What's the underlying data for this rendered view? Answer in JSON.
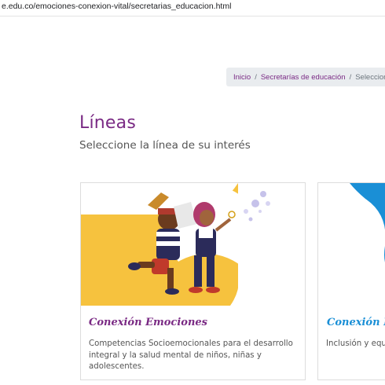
{
  "browser": {
    "url": "e.edu.co/emociones-conexion-vital/secretarias_educacion.html"
  },
  "breadcrumb": {
    "items": [
      "Inicio",
      "Secretarías de educación"
    ],
    "current": "Seleccionar líne"
  },
  "page": {
    "title": "Líneas",
    "subtitle": "Seleccione la línea de su interés"
  },
  "cards": [
    {
      "title": "Conexión Emociones",
      "description": "Competencias Socioemocionales para el desarrollo integral y la salud mental de niños, niñas y adolescentes.",
      "accent": "#7a2a84"
    },
    {
      "title": "Conexión In",
      "description": "Inclusión y equi",
      "accent": "#1a8fd6"
    }
  ],
  "colors": {
    "brand_purple": "#7a2a84",
    "brand_blue": "#1a8fd6",
    "card1_bg": "#f6c23e"
  }
}
